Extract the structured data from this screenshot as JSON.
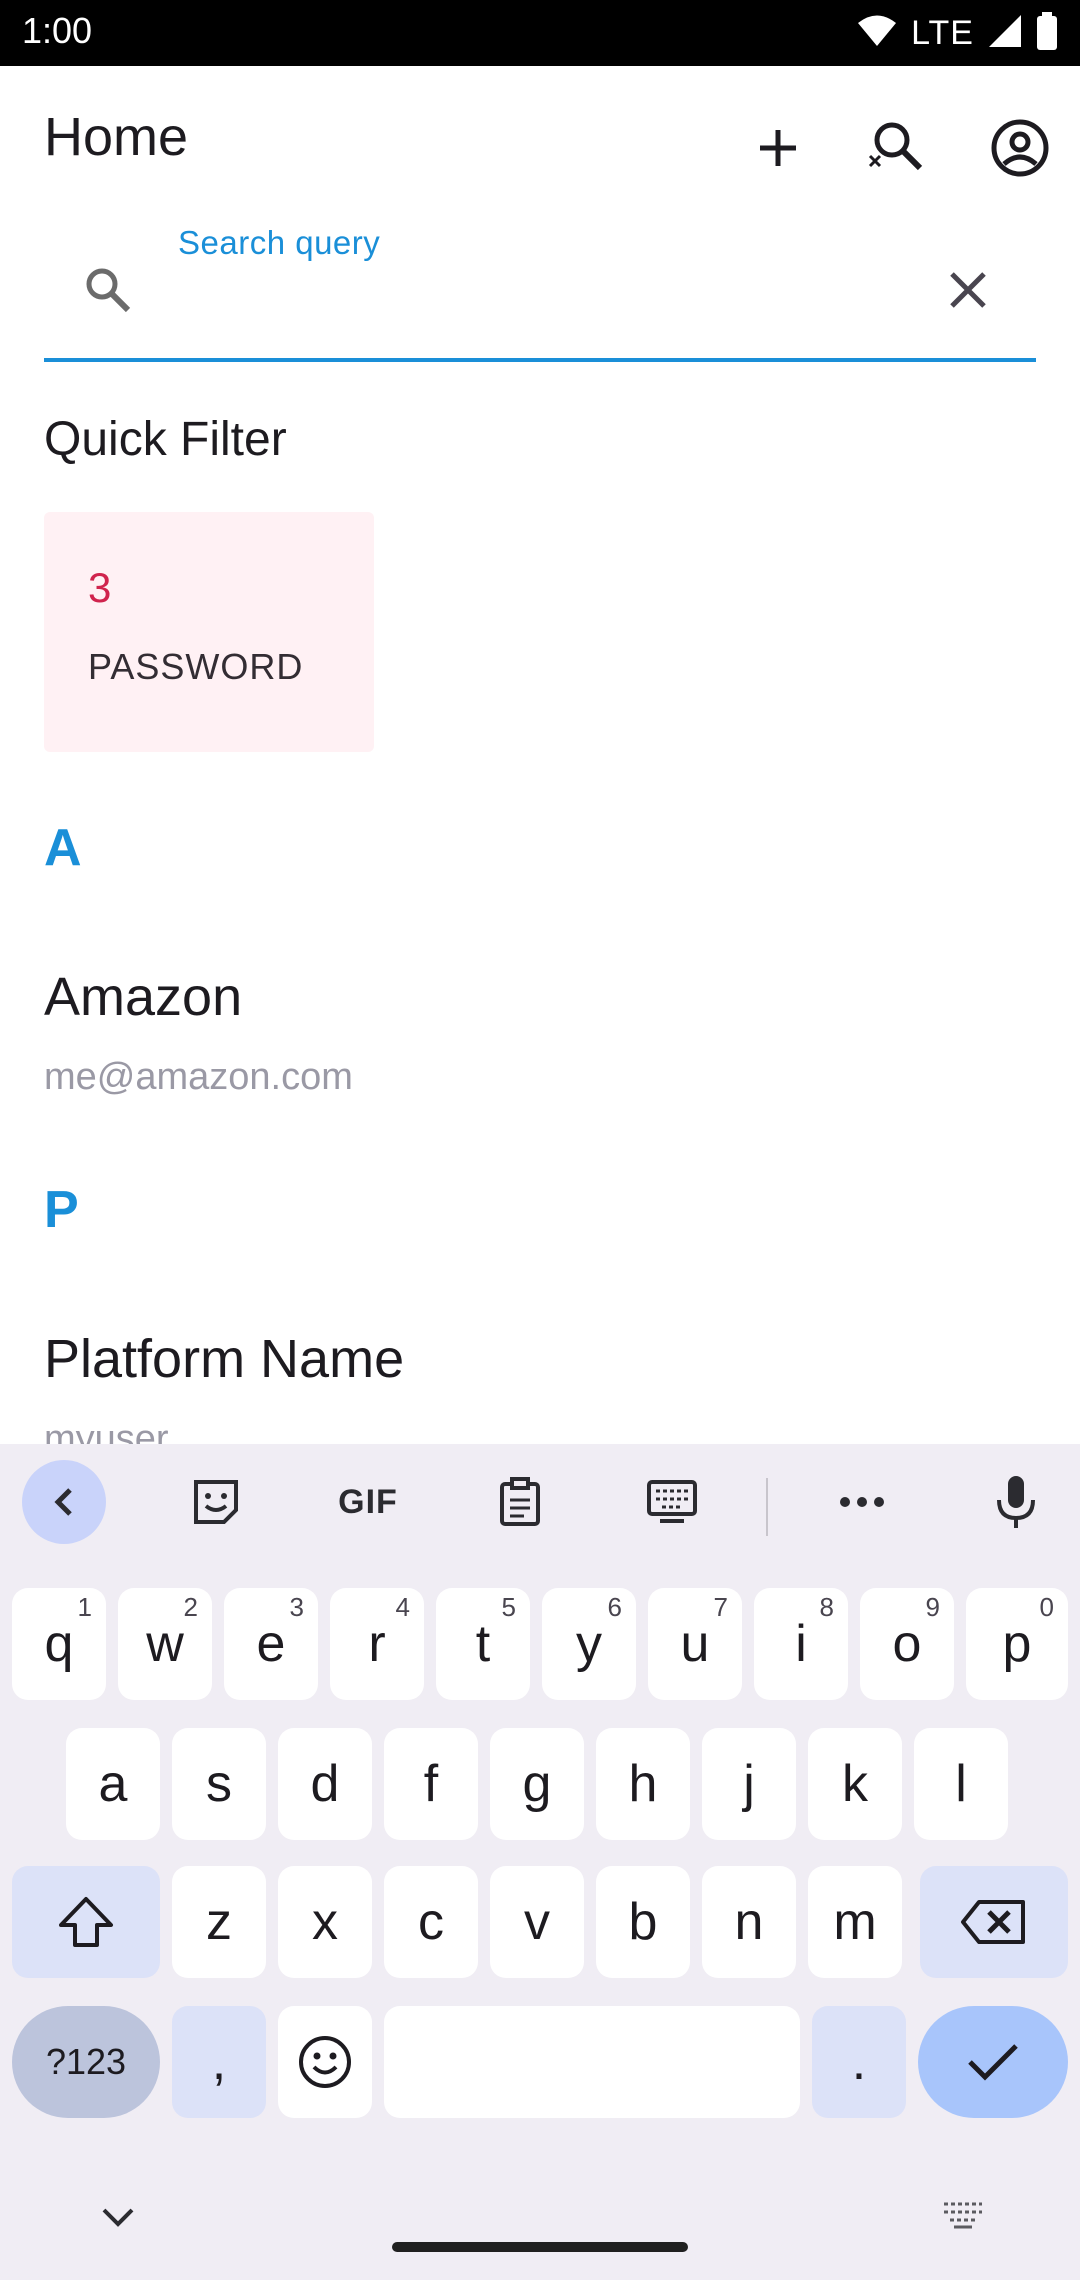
{
  "status_bar": {
    "time": "1:00",
    "network": "LTE"
  },
  "app_bar": {
    "title": "Home",
    "actions": [
      "add-icon",
      "search-off-icon",
      "account-circle-icon"
    ]
  },
  "search": {
    "label": "Search query",
    "value": ""
  },
  "quick_filter": {
    "title": "Quick Filter",
    "cards": [
      {
        "count": "3",
        "label": "PASSWORD"
      }
    ]
  },
  "sections": [
    {
      "letter": "A",
      "entries": [
        {
          "title": "Amazon",
          "subtitle": "me@amazon.com"
        }
      ]
    },
    {
      "letter": "P",
      "entries": [
        {
          "title": "Platform Name",
          "subtitle": "myuser"
        }
      ]
    }
  ],
  "keyboard": {
    "toolbar": [
      "back-icon",
      "sticker-icon",
      "GIF",
      "clipboard-icon",
      "keyboard-icon",
      "more-icon",
      "mic-icon"
    ],
    "row1": [
      {
        "key": "q",
        "hint": "1"
      },
      {
        "key": "w",
        "hint": "2"
      },
      {
        "key": "e",
        "hint": "3"
      },
      {
        "key": "r",
        "hint": "4"
      },
      {
        "key": "t",
        "hint": "5"
      },
      {
        "key": "y",
        "hint": "6"
      },
      {
        "key": "u",
        "hint": "7"
      },
      {
        "key": "i",
        "hint": "8"
      },
      {
        "key": "o",
        "hint": "9"
      },
      {
        "key": "p",
        "hint": "0"
      }
    ],
    "row2": [
      "a",
      "s",
      "d",
      "f",
      "g",
      "h",
      "j",
      "k",
      "l"
    ],
    "row3": [
      "z",
      "x",
      "c",
      "v",
      "b",
      "n",
      "m"
    ],
    "bottom": {
      "symbols": "?123",
      "comma": ",",
      "period": "."
    }
  },
  "colors": {
    "accent": "#1a8fd8",
    "filter_count": "#d0244d",
    "filter_bg": "#fff1f4"
  }
}
